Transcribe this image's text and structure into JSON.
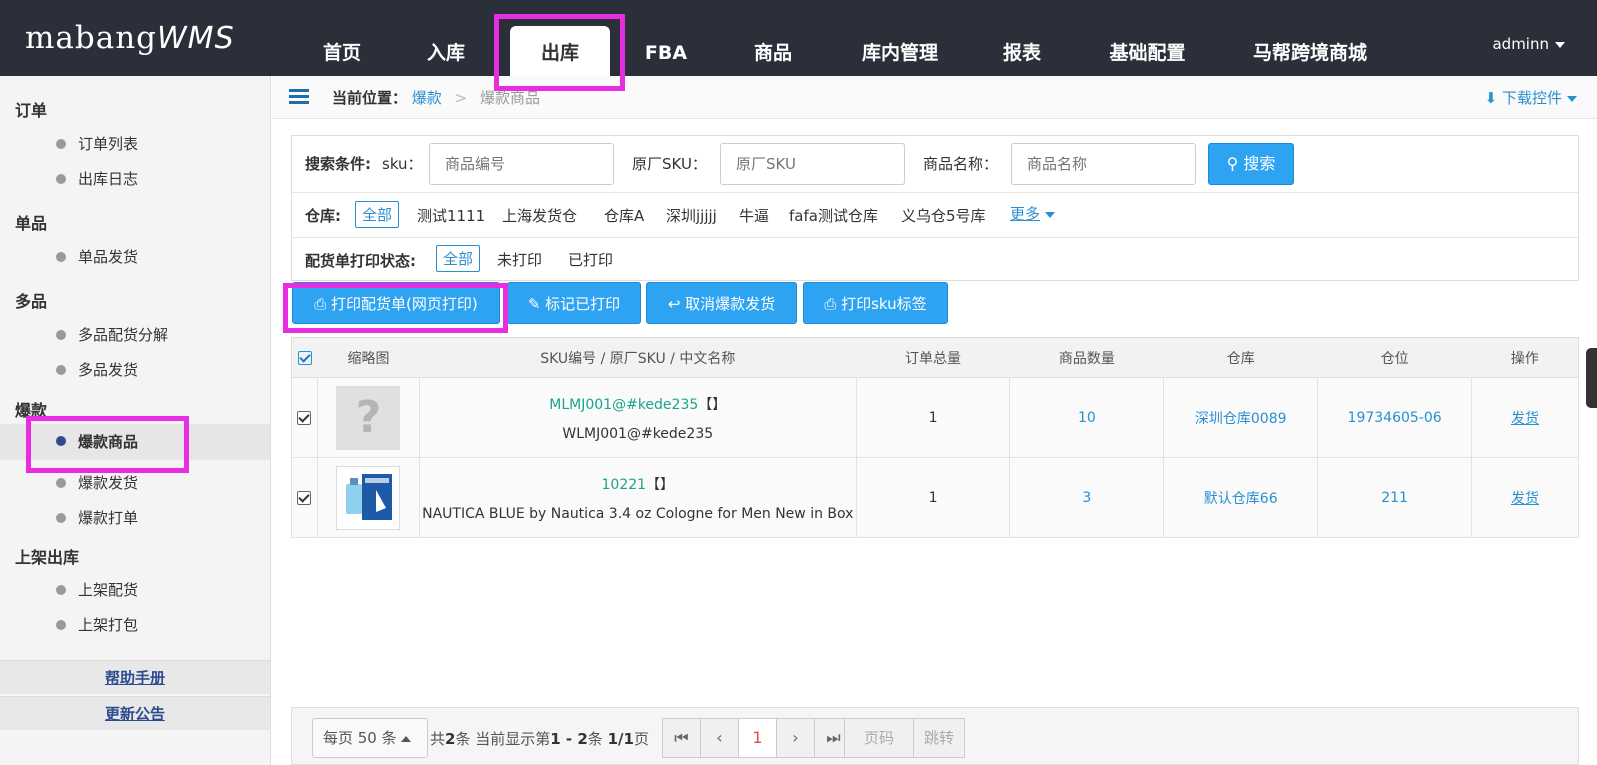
{
  "header": {
    "logo_main": "mabang",
    "logo_suffix": "WMS",
    "nav": [
      "首页",
      "入库",
      "出库",
      "FBA",
      "商品",
      "库内管理",
      "报表",
      "基础配置",
      "马帮跨境商城"
    ],
    "active_nav": "出库",
    "user": "adminn"
  },
  "sidebar": {
    "groups": [
      {
        "title": "订单",
        "items": [
          "订单列表",
          "出库日志"
        ]
      },
      {
        "title": "单品",
        "items": [
          "单品发货"
        ]
      },
      {
        "title": "多品",
        "items": [
          "多品配货分解",
          "多品发货"
        ]
      },
      {
        "title": "爆款",
        "items": [
          "爆款商品",
          "爆款发货",
          "爆款打单"
        ]
      },
      {
        "title": "上架出库",
        "items": [
          "上架配货",
          "上架打包"
        ]
      }
    ],
    "active_item": "爆款商品",
    "help": "帮助手册",
    "notice": "更新公告"
  },
  "breadcrumb": {
    "label": "当前位置：",
    "parent": "爆款",
    "current": "爆款商品",
    "download": "下载控件"
  },
  "search": {
    "label": "搜索条件:",
    "sku_label": "sku：",
    "sku_placeholder": "商品编号",
    "orig_label": "原厂SKU：",
    "orig_placeholder": "原厂SKU",
    "name_label": "商品名称：",
    "name_placeholder": "商品名称",
    "button": "搜索"
  },
  "warehouse": {
    "label": "仓库:",
    "options": [
      "全部",
      "测试1111",
      "上海发货仓",
      "仓库A",
      "深圳jjjjj",
      "牛逼",
      "fafa测试仓库",
      "义乌仓5号库"
    ],
    "selected": "全部",
    "more": "更多"
  },
  "print_status": {
    "label": "配货单打印状态:",
    "options": [
      "全部",
      "未打印",
      "已打印"
    ],
    "selected": "全部"
  },
  "actions": {
    "print_pick": "打印配货单(网页打印)",
    "mark_printed": "标记已打印",
    "cancel_ship": "取消爆款发货",
    "print_sku": "打印sku标签"
  },
  "table": {
    "columns": [
      "缩略图",
      "SKU编号 / 原厂SKU / 中文名称",
      "订单总量",
      "商品数量",
      "仓库",
      "仓位",
      "操作"
    ],
    "rows": [
      {
        "sku": "MLMJ001@#kede235",
        "sku_suffix": "【】",
        "name": "WLMJ001@#kede235",
        "orders": "1",
        "qty": "10",
        "warehouse": "深圳仓库0089",
        "location": "19734605-06",
        "op": "发货",
        "thumb": "placeholder"
      },
      {
        "sku": "10221",
        "sku_suffix": "【】",
        "name": "NAUTICA BLUE by Nautica 3.4 oz Cologne for Men New in Box",
        "orders": "1",
        "qty": "3",
        "warehouse": "默认仓库66",
        "location": "211",
        "op": "发货",
        "thumb": "product"
      }
    ]
  },
  "pager": {
    "size": "每页 50 条",
    "total_prefix": "共",
    "total": "2",
    "total_mid": "条 当前显示第",
    "range": "1 - 2",
    "range_mid": "条",
    "pages": "1/1",
    "pages_suffix": "页",
    "current": "1",
    "page_placeholder": "页码",
    "jump": "跳转"
  }
}
